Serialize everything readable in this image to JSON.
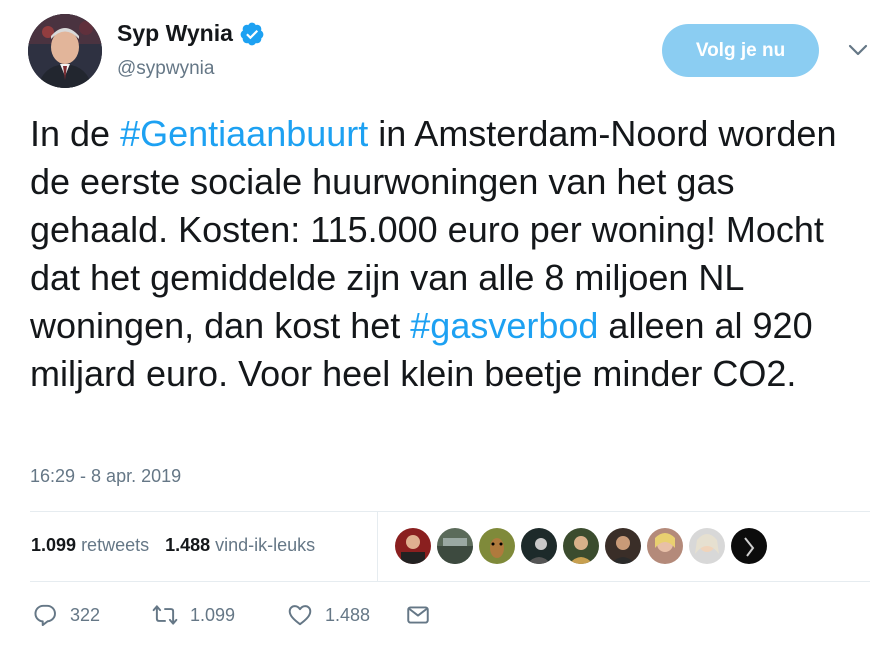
{
  "author": {
    "display_name": "Syp Wynia",
    "handle": "@sypwynia",
    "verified": true
  },
  "follow_button": "Volg je nu",
  "tweet": {
    "segments": [
      {
        "text": "In de ",
        "hashtag": false
      },
      {
        "text": "#Gentiaanbuurt",
        "hashtag": true
      },
      {
        "text": " in Amsterdam-Noord worden de eerste sociale huurwoningen van het gas gehaald. Kosten: 115.000 euro per woning! Mocht dat het gemiddelde zijn van alle 8 miljoen NL woningen, dan kost het ",
        "hashtag": false
      },
      {
        "text": "#gasverbod",
        "hashtag": true
      },
      {
        "text": " alleen al 920 miljard euro. Voor heel klein beetje minder CO2.",
        "hashtag": false
      }
    ]
  },
  "timestamp": "16:29 - 8 apr. 2019",
  "stats": {
    "retweets_count": "1.099",
    "retweets_label": "retweets",
    "likes_count": "1.488",
    "likes_label": "vind-ik-leuks"
  },
  "likers_count": 9,
  "actions": {
    "replies": "322",
    "retweets": "1.099",
    "likes": "1.488"
  },
  "colors": {
    "accent": "#1da1f2",
    "follow_button_bg": "#8bcdf2",
    "muted": "#657786",
    "text": "#14171a",
    "divider": "#e6ecf0"
  }
}
